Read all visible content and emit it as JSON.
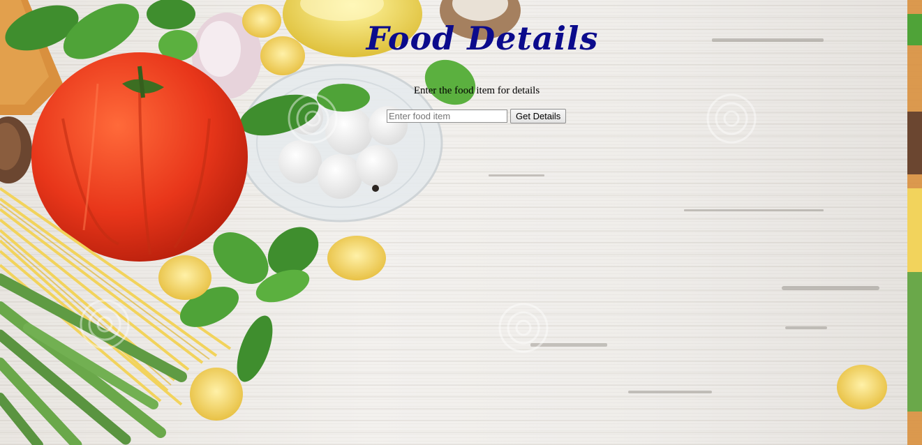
{
  "page": {
    "title": "Food Details",
    "instruction": "Enter the food item for details"
  },
  "search": {
    "placeholder": "Enter food item",
    "value": "",
    "button_label": "Get Details"
  },
  "colors": {
    "title": "#0b0b8c",
    "background": "#efedea",
    "tomato": "#e8361a",
    "basil": "#3f8e2e",
    "pasta": "#f2d35c"
  },
  "icons": [
    "watermark-icon"
  ]
}
